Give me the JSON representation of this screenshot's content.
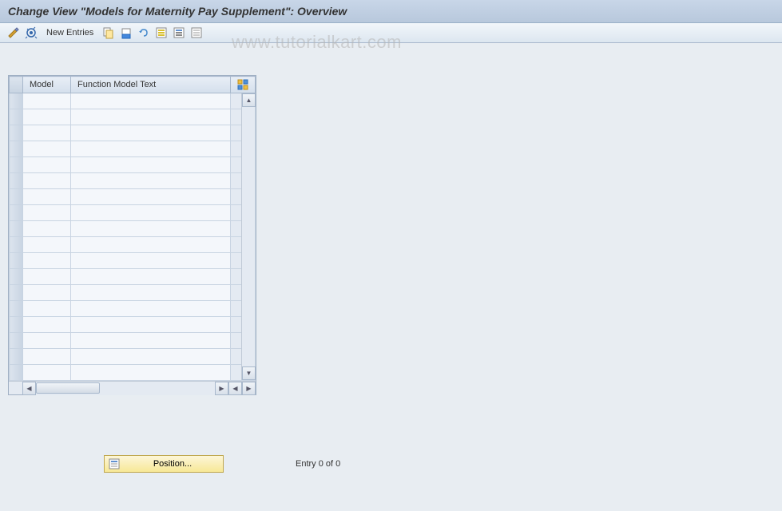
{
  "title": "Change View \"Models for Maternity Pay Supplement\": Overview",
  "toolbar": {
    "new_entries": "New Entries"
  },
  "table": {
    "columns": {
      "model": "Model",
      "text": "Function Model Text"
    },
    "rows": [
      {
        "model": "",
        "text": ""
      },
      {
        "model": "",
        "text": ""
      },
      {
        "model": "",
        "text": ""
      },
      {
        "model": "",
        "text": ""
      },
      {
        "model": "",
        "text": ""
      },
      {
        "model": "",
        "text": ""
      },
      {
        "model": "",
        "text": ""
      },
      {
        "model": "",
        "text": ""
      },
      {
        "model": "",
        "text": ""
      },
      {
        "model": "",
        "text": ""
      },
      {
        "model": "",
        "text": ""
      },
      {
        "model": "",
        "text": ""
      },
      {
        "model": "",
        "text": ""
      },
      {
        "model": "",
        "text": ""
      },
      {
        "model": "",
        "text": ""
      },
      {
        "model": "",
        "text": ""
      },
      {
        "model": "",
        "text": ""
      },
      {
        "model": "",
        "text": ""
      }
    ]
  },
  "footer": {
    "position_button": "Position...",
    "entry_status": "Entry 0 of 0"
  },
  "watermark": "www.tutorialkart.com"
}
